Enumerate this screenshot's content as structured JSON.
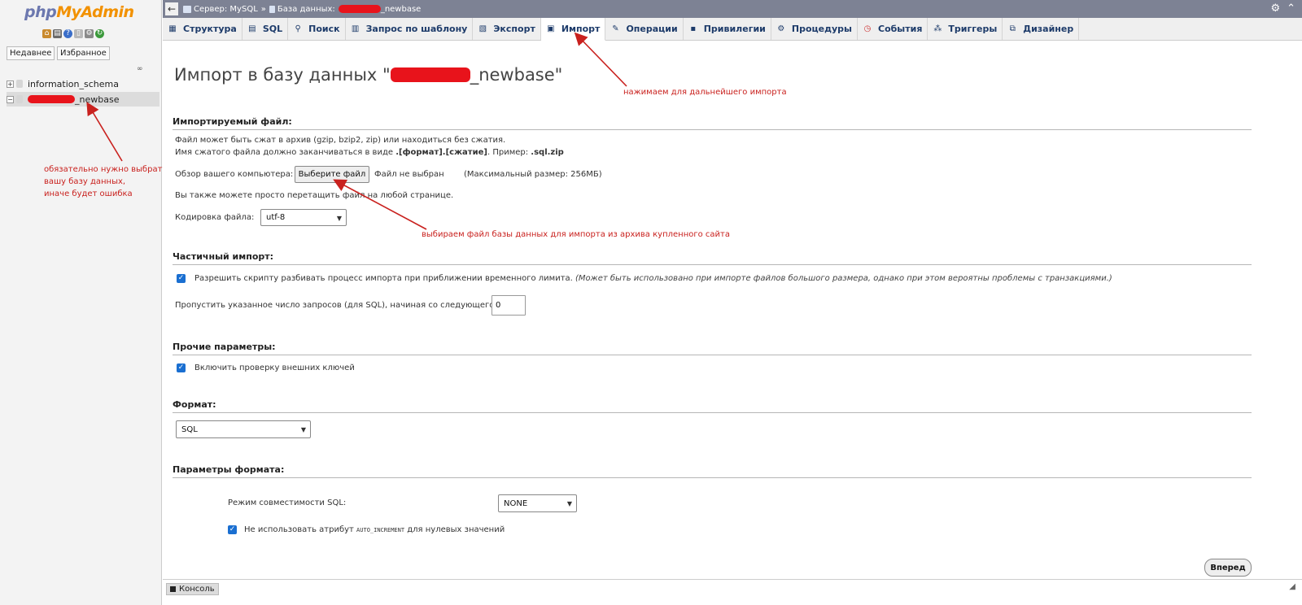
{
  "nav": {
    "logo_part1": "php",
    "logo_part2": "MyAdmin",
    "recent_label": "Недавнее",
    "favorites_label": "Избранное",
    "databases": [
      {
        "name": "information_schema"
      },
      {
        "name": "_newbase"
      }
    ]
  },
  "topbar": {
    "server_crumb": "Сервер: MySQL",
    "separator": "»",
    "db_crumb_prefix": "База данных:",
    "db_crumb_suffix": "_newbase"
  },
  "tabs": [
    {
      "label": "Структура",
      "icon": "structure-icon"
    },
    {
      "label": "SQL",
      "icon": "sql-icon"
    },
    {
      "label": "Поиск",
      "icon": "search-icon"
    },
    {
      "label": "Запрос по шаблону",
      "icon": "query-icon"
    },
    {
      "label": "Экспорт",
      "icon": "export-icon"
    },
    {
      "label": "Импорт",
      "icon": "import-icon",
      "active": true
    },
    {
      "label": "Операции",
      "icon": "wrench-icon"
    },
    {
      "label": "Привилегии",
      "icon": "privileges-icon"
    },
    {
      "label": "Процедуры",
      "icon": "routines-icon"
    },
    {
      "label": "События",
      "icon": "events-icon"
    },
    {
      "label": "Триггеры",
      "icon": "triggers-icon"
    },
    {
      "label": "Дизайнер",
      "icon": "designer-icon"
    }
  ],
  "main": {
    "title_prefix": "Импорт в базу данных \"",
    "title_suffix": "_newbase\"",
    "file_section": {
      "heading": "Импортируемый файл:",
      "note1": "Файл может быть сжат в архив (gzip, bzip2, zip) или находиться без сжатия.",
      "note2_a": "Имя сжатого файла должно заканчиваться в виде ",
      "note2_b": ".[формат].[сжатие]",
      "note2_c": ". Пример: ",
      "note2_d": ".sql.zip",
      "browse_label": "Обзор вашего компьютера:",
      "choose_button": "Выберите файл",
      "no_file": "Файл не выбран",
      "max_size": "(Максимальный размер: 256МБ)",
      "drag_note": "Вы также можете просто перетащить файл на любой странице.",
      "charset_label": "Кодировка файла:",
      "charset_value": "utf-8"
    },
    "partial_section": {
      "heading": "Частичный импорт:",
      "allow_interrupt": "Разрешить скрипту разбивать процесс импорта при приближении временного лимита.",
      "allow_interrupt_note": "(Может быть использовано при импорте файлов большого размера, однако при этом вероятны проблемы с транзакциями.)",
      "skip_label": "Пропустить указанное число запросов (для SQL), начиная со следующего:",
      "skip_value": "0"
    },
    "other_section": {
      "heading": "Прочие параметры:",
      "fk_checks": "Включить проверку внешних ключей"
    },
    "format_section": {
      "heading": "Формат:",
      "format_value": "SQL"
    },
    "format_options_section": {
      "heading": "Параметры формата:",
      "compat_label": "Режим совместимости SQL:",
      "compat_value": "NONE",
      "no_auto_value_a": "Не использовать атрибут ",
      "no_auto_value_code": "AUTO_INCREMENT",
      "no_auto_value_b": " для нулевых значений"
    },
    "go_button": "Вперед"
  },
  "console": {
    "label": "Консоль"
  },
  "annotations": {
    "import_tab_note": "нажимаем для дальнейшего импорта",
    "choose_file_note": "выбираем файл базы данных для импорта из архива купленного сайта",
    "select_db_note_1": "обязательно нужно выбрать",
    "select_db_note_2": "вашу базу данных,",
    "select_db_note_3": "иначе будет ошибка"
  },
  "colors": {
    "annotation": "#c9211e",
    "topbar": "#7d8294",
    "tab_text": "#1d3b6a",
    "checkbox": "#1a6fd1",
    "redaction": "#e8131b"
  }
}
